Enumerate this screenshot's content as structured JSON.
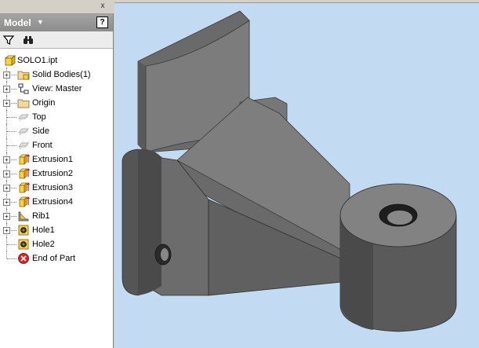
{
  "panel": {
    "title": "Model",
    "help_label": "?",
    "close_label": "x"
  },
  "toolbar": {
    "filter_icon": "filter-icon",
    "find_icon": "binoculars-icon"
  },
  "tree": {
    "root": {
      "label": "SOLO1.ipt",
      "icon": "part-file-icon"
    },
    "items": [
      {
        "label": "Solid Bodies(1)",
        "icon": "solid-bodies-folder-icon",
        "expandable": true
      },
      {
        "label": "View: Master",
        "icon": "view-rep-icon",
        "expandable": true
      },
      {
        "label": "Origin",
        "icon": "folder-icon",
        "expandable": true
      },
      {
        "label": "Top",
        "icon": "work-plane-icon",
        "expandable": false
      },
      {
        "label": "Side",
        "icon": "work-plane-icon",
        "expandable": false
      },
      {
        "label": "Front",
        "icon": "work-plane-icon",
        "expandable": false
      },
      {
        "label": "Extrusion1",
        "icon": "extrusion-icon",
        "expandable": true
      },
      {
        "label": "Extrusion2",
        "icon": "extrusion-icon",
        "expandable": true
      },
      {
        "label": "Extrusion3",
        "icon": "extrusion-icon",
        "expandable": true
      },
      {
        "label": "Extrusion4",
        "icon": "extrusion-icon",
        "expandable": true
      },
      {
        "label": "Rib1",
        "icon": "rib-icon",
        "expandable": true
      },
      {
        "label": "Hole1",
        "icon": "hole-icon",
        "expandable": true
      },
      {
        "label": "Hole2",
        "icon": "hole-icon",
        "expandable": false
      },
      {
        "label": "End of Part",
        "icon": "end-of-part-icon",
        "expandable": false
      }
    ]
  },
  "colors": {
    "viewport_background": "#c3dbf2",
    "panel_header": "#999999",
    "model_face_light": "#8a8a8a",
    "model_face_mid": "#6e6e6e",
    "model_face_dark": "#4c4c4c"
  }
}
